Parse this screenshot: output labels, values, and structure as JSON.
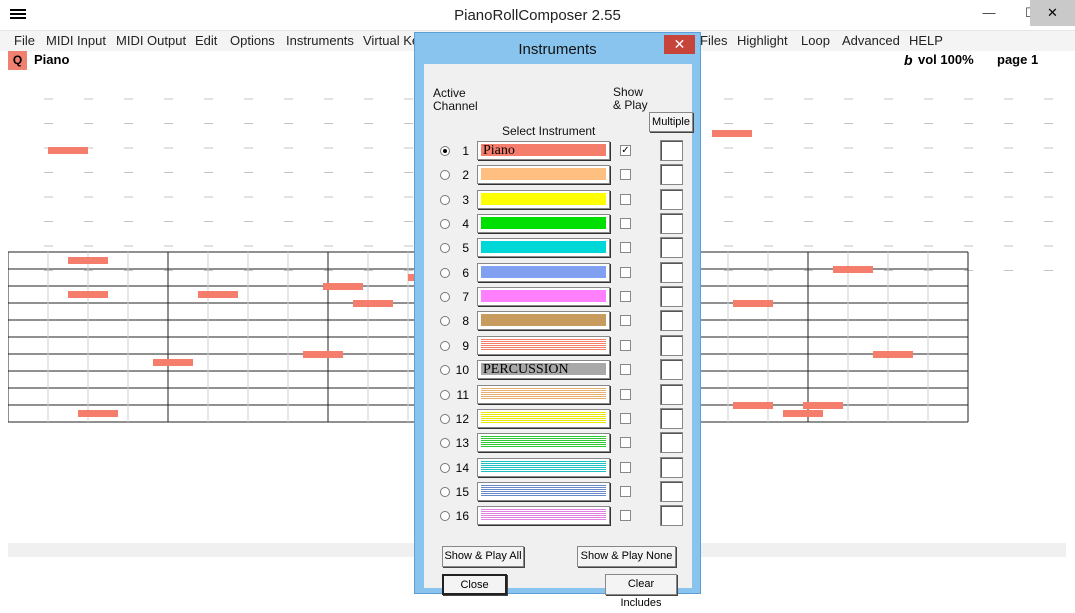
{
  "window": {
    "title": "PianoRollComposer 2.55",
    "min_glyph": "—",
    "max_glyph": "☐",
    "close_glyph": "✕"
  },
  "menu": [
    {
      "label": "File",
      "id": "file"
    },
    {
      "label": "MIDI Input",
      "id": "midi-input"
    },
    {
      "label": "MIDI Output",
      "id": "midi-output"
    },
    {
      "label": "Edit",
      "id": "edit"
    },
    {
      "label": "Options",
      "id": "options"
    },
    {
      "label": "Instruments",
      "id": "instruments"
    },
    {
      "label": "Virtual Ke",
      "id": "virtual-keyboard"
    },
    {
      "label": "Files",
      "id": "files"
    },
    {
      "label": "Highlight",
      "id": "highlight"
    },
    {
      "label": "Loop",
      "id": "loop"
    },
    {
      "label": "Advanced",
      "id": "advanced"
    },
    {
      "label": "HELP",
      "id": "help"
    }
  ],
  "header": {
    "q_label": "Q",
    "instrument": "Piano",
    "flat_symbol": "b",
    "volume": "vol 100%",
    "page": "page 1"
  },
  "colors": {
    "note": "#f47d6b",
    "dialog_frame": "#89c4ee",
    "close_red": "#c7443a"
  },
  "dialog": {
    "title": "Instruments",
    "close_glyph": "✕",
    "active_channel_label": [
      "Active",
      "Channel"
    ],
    "select_instrument_label": "Select Instrument",
    "show_play_label": [
      "Show",
      "& Play"
    ],
    "multiple_label": "Multiple",
    "selected_channel": 1,
    "channels": [
      {
        "num": "1",
        "color": "#f47d6b",
        "pattern": "solid",
        "label": "Piano",
        "show": true
      },
      {
        "num": "2",
        "color": "#ffbf80",
        "pattern": "solid",
        "label": "",
        "show": false
      },
      {
        "num": "3",
        "color": "#ffff00",
        "pattern": "solid",
        "label": "",
        "show": false
      },
      {
        "num": "4",
        "color": "#00e000",
        "pattern": "solid",
        "label": "",
        "show": false
      },
      {
        "num": "5",
        "color": "#00d8d8",
        "pattern": "solid",
        "label": "",
        "show": false
      },
      {
        "num": "6",
        "color": "#80a0f0",
        "pattern": "solid",
        "label": "",
        "show": false
      },
      {
        "num": "7",
        "color": "#ff80ff",
        "pattern": "solid",
        "label": "",
        "show": false
      },
      {
        "num": "8",
        "color": "#c89b5e",
        "pattern": "solid",
        "label": "",
        "show": false
      },
      {
        "num": "9",
        "color": "#f47d6b",
        "pattern": "striped",
        "label": "",
        "show": false
      },
      {
        "num": "10",
        "color": "#a8a8a8",
        "pattern": "solid",
        "label": "PERCUSSION",
        "show": false
      },
      {
        "num": "11",
        "color": "#e8b070",
        "pattern": "striped",
        "label": "",
        "show": false
      },
      {
        "num": "12",
        "color": "#e8e800",
        "pattern": "striped",
        "label": "",
        "show": false
      },
      {
        "num": "13",
        "color": "#30c830",
        "pattern": "striped",
        "label": "",
        "show": false
      },
      {
        "num": "14",
        "color": "#20c0c0",
        "pattern": "striped",
        "label": "",
        "show": false
      },
      {
        "num": "15",
        "color": "#6888c8",
        "pattern": "striped",
        "label": "",
        "show": false
      },
      {
        "num": "16",
        "color": "#e080e0",
        "pattern": "striped",
        "label": "",
        "show": false
      }
    ],
    "buttons": {
      "show_play_all": "Show & Play All",
      "show_play_none": "Show & Play None",
      "close": "Close",
      "clear_includes": "Clear Includes"
    }
  }
}
